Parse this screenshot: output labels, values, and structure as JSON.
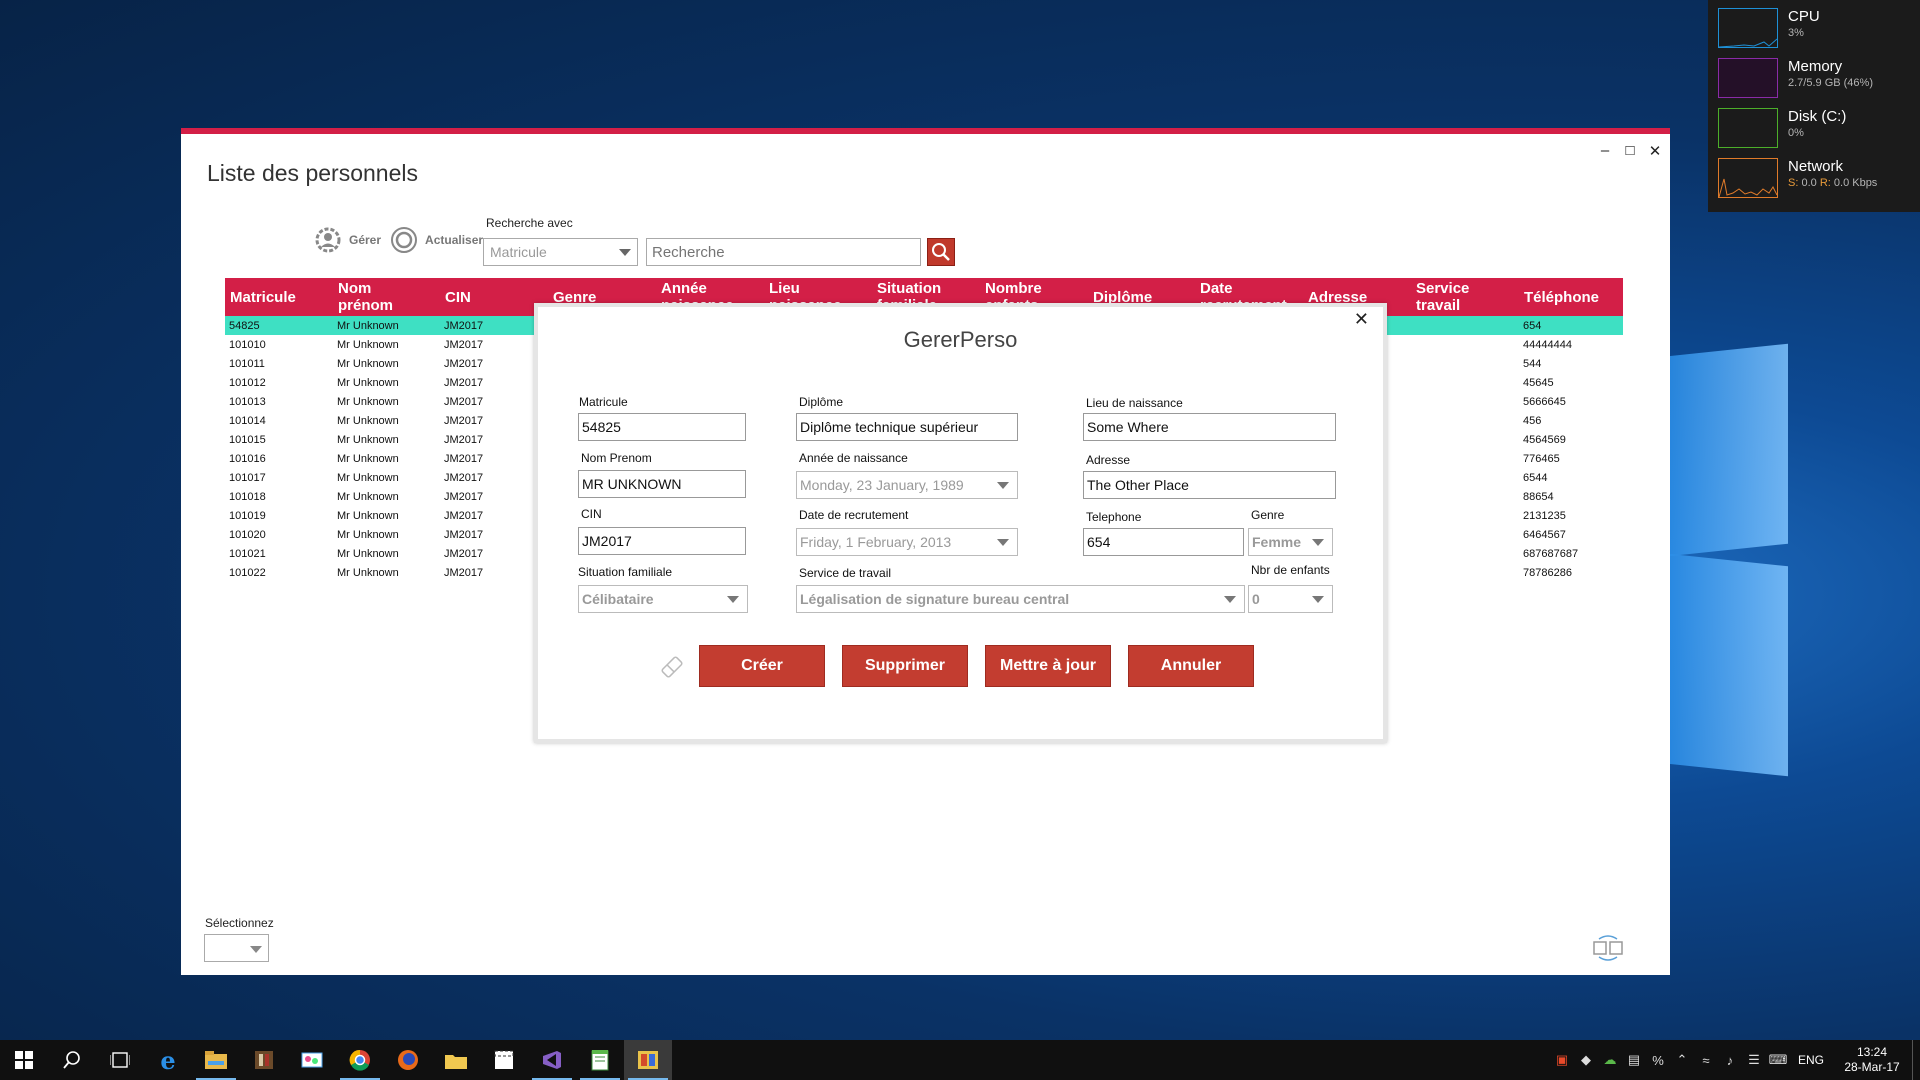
{
  "perf": [
    {
      "name": "CPU",
      "value": "3%",
      "color": "#1e90d6"
    },
    {
      "name": "Memory",
      "value": "2.7/5.9 GB (46%)",
      "color": "#8a2ba8"
    },
    {
      "name": "Disk (C:)",
      "value": "0%",
      "color": "#4caf2a"
    },
    {
      "name": "Network",
      "s_label": "S:",
      "s_value": "0.0",
      "r_label": "R:",
      "r_value": "0.0 Kbps",
      "color": "#e07b2a"
    }
  ],
  "app": {
    "title": "Liste des personnels",
    "toolbar": {
      "manage": "Gérer",
      "refresh": "Actualiser"
    },
    "search_with_label": "Recherche avec",
    "search_field": "Matricule",
    "search_placeholder": "Recherche",
    "columns": [
      {
        "l1": "Matricule",
        "l2": ""
      },
      {
        "l1": "Nom",
        "l2": "prénom"
      },
      {
        "l1": "CIN",
        "l2": ""
      },
      {
        "l1": "Genre",
        "l2": ""
      },
      {
        "l1": "Année",
        "l2": "naissance"
      },
      {
        "l1": "Lieu",
        "l2": "naissance"
      },
      {
        "l1": "Situation",
        "l2": "familiale"
      },
      {
        "l1": "Nombre",
        "l2": "enfants"
      },
      {
        "l1": "Diplôme",
        "l2": ""
      },
      {
        "l1": "Date",
        "l2": "recrutement"
      },
      {
        "l1": "Adresse",
        "l2": ""
      },
      {
        "l1": "Service",
        "l2": "travail"
      },
      {
        "l1": "Téléphone",
        "l2": ""
      }
    ],
    "rows": [
      {
        "mat": "54825",
        "nom": "Mr Unknown",
        "cin": "JM2017",
        "tel": "654"
      },
      {
        "mat": "101010",
        "nom": "Mr Unknown",
        "cin": "JM2017",
        "tel": "44444444"
      },
      {
        "mat": "101011",
        "nom": "Mr Unknown",
        "cin": "JM2017",
        "tel": "544"
      },
      {
        "mat": "101012",
        "nom": "Mr Unknown",
        "cin": "JM2017",
        "tel": "45645"
      },
      {
        "mat": "101013",
        "nom": "Mr Unknown",
        "cin": "JM2017",
        "tel": "5666645"
      },
      {
        "mat": "101014",
        "nom": "Mr Unknown",
        "cin": "JM2017",
        "tel": "456"
      },
      {
        "mat": "101015",
        "nom": "Mr Unknown",
        "cin": "JM2017",
        "tel": "4564569"
      },
      {
        "mat": "101016",
        "nom": "Mr Unknown",
        "cin": "JM2017",
        "tel": "776465"
      },
      {
        "mat": "101017",
        "nom": "Mr Unknown",
        "cin": "JM2017",
        "tel": "6544"
      },
      {
        "mat": "101018",
        "nom": "Mr Unknown",
        "cin": "JM2017",
        "tel": "88654"
      },
      {
        "mat": "101019",
        "nom": "Mr Unknown",
        "cin": "JM2017",
        "tel": "2131235"
      },
      {
        "mat": "101020",
        "nom": "Mr Unknown",
        "cin": "JM2017",
        "tel": "6464567"
      },
      {
        "mat": "101021",
        "nom": "Mr Unknown",
        "cin": "JM2017",
        "tel": "687687687"
      },
      {
        "mat": "101022",
        "nom": "Mr Unknown",
        "cin": "JM2017",
        "tel": "78786286"
      }
    ],
    "select_label": "Sélectionnez"
  },
  "dialog": {
    "title": "GererPerso",
    "labels": {
      "matricule": "Matricule",
      "diplome": "Diplôme",
      "lieu": "Lieu de naissance",
      "nom": "Nom Prenom",
      "annee": "Année de naissance",
      "adresse": "Adresse",
      "cin": "CIN",
      "date_rec": "Date de recrutement",
      "tel": "Telephone",
      "genre": "Genre",
      "situation": "Situation familiale",
      "service": "Service de travail",
      "enfants": "Nbr de enfants"
    },
    "values": {
      "matricule": "54825",
      "diplome": "Diplôme technique supérieur",
      "lieu": "Some Where",
      "nom": "MR UNKNOWN",
      "annee": "Monday, 23 January, 1989",
      "adresse": "The Other Place",
      "cin": "JM2017",
      "date_rec": "Friday, 1 February, 2013",
      "tel": "654",
      "genre": "Femme",
      "situation": "Célibataire",
      "service": "Légalisation de signature bureau central",
      "enfants": "0"
    },
    "buttons": {
      "create": "Créer",
      "delete": "Supprimer",
      "update": "Mettre à jour",
      "cancel": "Annuler"
    }
  },
  "taskbar": {
    "apps": [
      "start-icon",
      "search-icon",
      "task-view-icon",
      "edge-icon",
      "file-explorer-icon",
      "app-icon",
      "paint-icon",
      "chrome-icon",
      "firefox-icon",
      "folder-icon",
      "clapper-icon",
      "visual-studio-icon",
      "notepad-icon",
      "wpf-app-icon"
    ],
    "lang": "ENG",
    "time": "13:24",
    "date": "28-Mar-17"
  },
  "colors": {
    "accent": "#d31f47",
    "button": "#c33d30",
    "selected_row": "#3ee0c3"
  }
}
